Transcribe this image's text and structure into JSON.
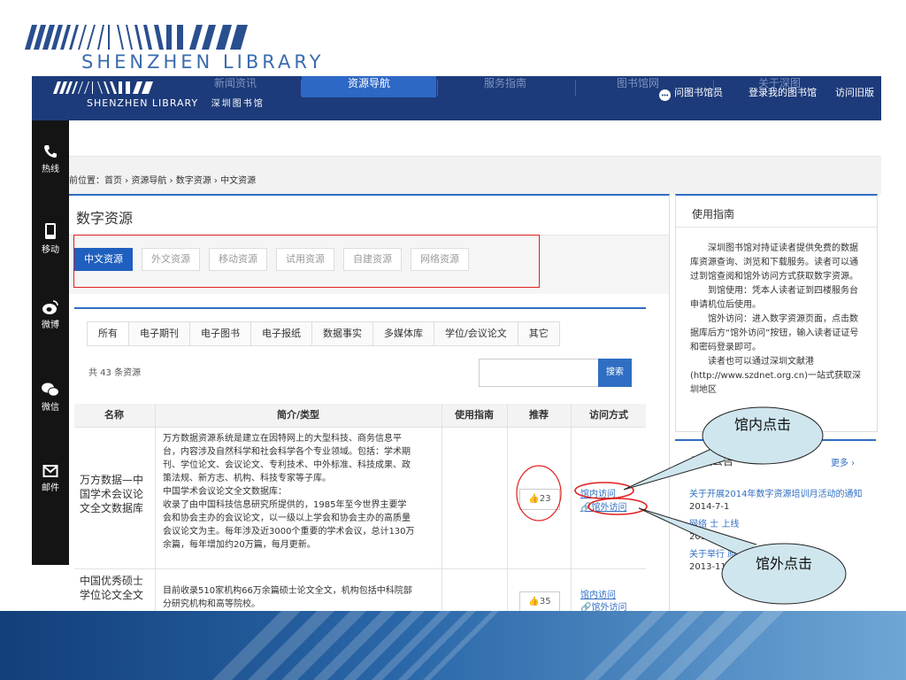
{
  "slide": {
    "logo_text": "SHENZHEN LIBRARY"
  },
  "header": {
    "logo_en": "SHENZHEN LIBRARY",
    "logo_cn": "深圳图书馆",
    "nav": [
      "新闻资讯",
      "资源导航",
      "服务指南",
      "图书馆网",
      "关于深图"
    ],
    "active_nav": "资源导航",
    "links": [
      "问图书馆员",
      "登录我的图书馆",
      "访问旧版"
    ]
  },
  "floatbar": {
    "items": [
      {
        "label": "热线",
        "icon": "phone-icon"
      },
      {
        "label": "移动",
        "icon": "mobile-icon"
      },
      {
        "label": "微博",
        "icon": "weibo-icon"
      },
      {
        "label": "微信",
        "icon": "wechat-icon"
      },
      {
        "label": "邮件",
        "icon": "mail-icon"
      }
    ]
  },
  "breadcrumb": "前位置：首页 › 资源导航 › 数字资源 › 中文资源",
  "main": {
    "title": "数字资源",
    "resource_tabs": [
      "中文资源",
      "外文资源",
      "移动资源",
      "试用资源",
      "自建资源",
      "网络资源"
    ],
    "active_resource_tab": "中文资源",
    "category_tabs": [
      "所有",
      "电子期刊",
      "电子图书",
      "电子报纸",
      "数据事实",
      "多媒体库",
      "学位/会议论文",
      "其它"
    ],
    "count_text": "共 43 条资源",
    "search_button": "搜索",
    "columns": [
      "名称",
      "简介/类型",
      "使用指南",
      "推荐",
      "访问方式"
    ],
    "rows": [
      {
        "name": "万方数据—中国学术会议论文全文数据库",
        "desc_lines": [
          "万方数据资源系统是建立在因特网上的大型科技、商务信息平",
          "台，内容涉及自然科学和社会科学各个专业领域。包括：学术期",
          "刊、学位论文、会议论文、专利技术、中外标准、科技成果、政",
          "策法规、新方志、机构、科技专家等子库。",
          "中国学术会议论文全文数据库：",
          "收录了由中国科技信息研究所提供的，1985年至今世界主要学",
          "会和协会主办的会议论文，以一级以上学会和协会主办的高质量",
          "会议论文为主。每年涉及近3000个重要的学术会议，总计130万",
          "余篇，每年增加约20万篇，每月更新。"
        ],
        "likes": "23",
        "access_in": "馆内访问",
        "access_out": "馆外访问"
      },
      {
        "name": "中国优秀硕士学位论文全文",
        "desc_lines": [
          "目前收录510家机构66万余篇硕士论文全文，机构包括中科院部",
          "分研究机构和高等院校。"
        ],
        "likes": "35",
        "access_in": "馆内访问",
        "access_out": "馆外访问"
      }
    ]
  },
  "guide": {
    "title": "使用指南",
    "paragraphs": [
      "深圳图书馆对持证读者提供免费的数据库资源查询、浏览和下载服务。读者可以通过到馆查阅和馆外访问方式获取数字资源。",
      "到馆使用：凭本人读者证到四楼服务台申请机位后使用。",
      "馆外访问：进入数字资源页面，点击数据库后方“馆外访问”按钮，输入读者证证号和密码登录即可。",
      "读者也可以通过深圳文献港(http://www.szdnet.org.cn)一站式获取深圳地区"
    ]
  },
  "notice": {
    "title": "资讯公告",
    "more": "更多 ›",
    "items": [
      {
        "title": "关于开展2014年数字资源培训月活动的通知",
        "date": "2014-7-1"
      },
      {
        "title": "网络      士     上线",
        "date": "2014-1-"
      },
      {
        "title": "关于举行        原利用技能大赛",
        "date": "2013-11-13"
      }
    ]
  },
  "callouts": {
    "in": "馆内点击",
    "out": "馆外点击"
  }
}
